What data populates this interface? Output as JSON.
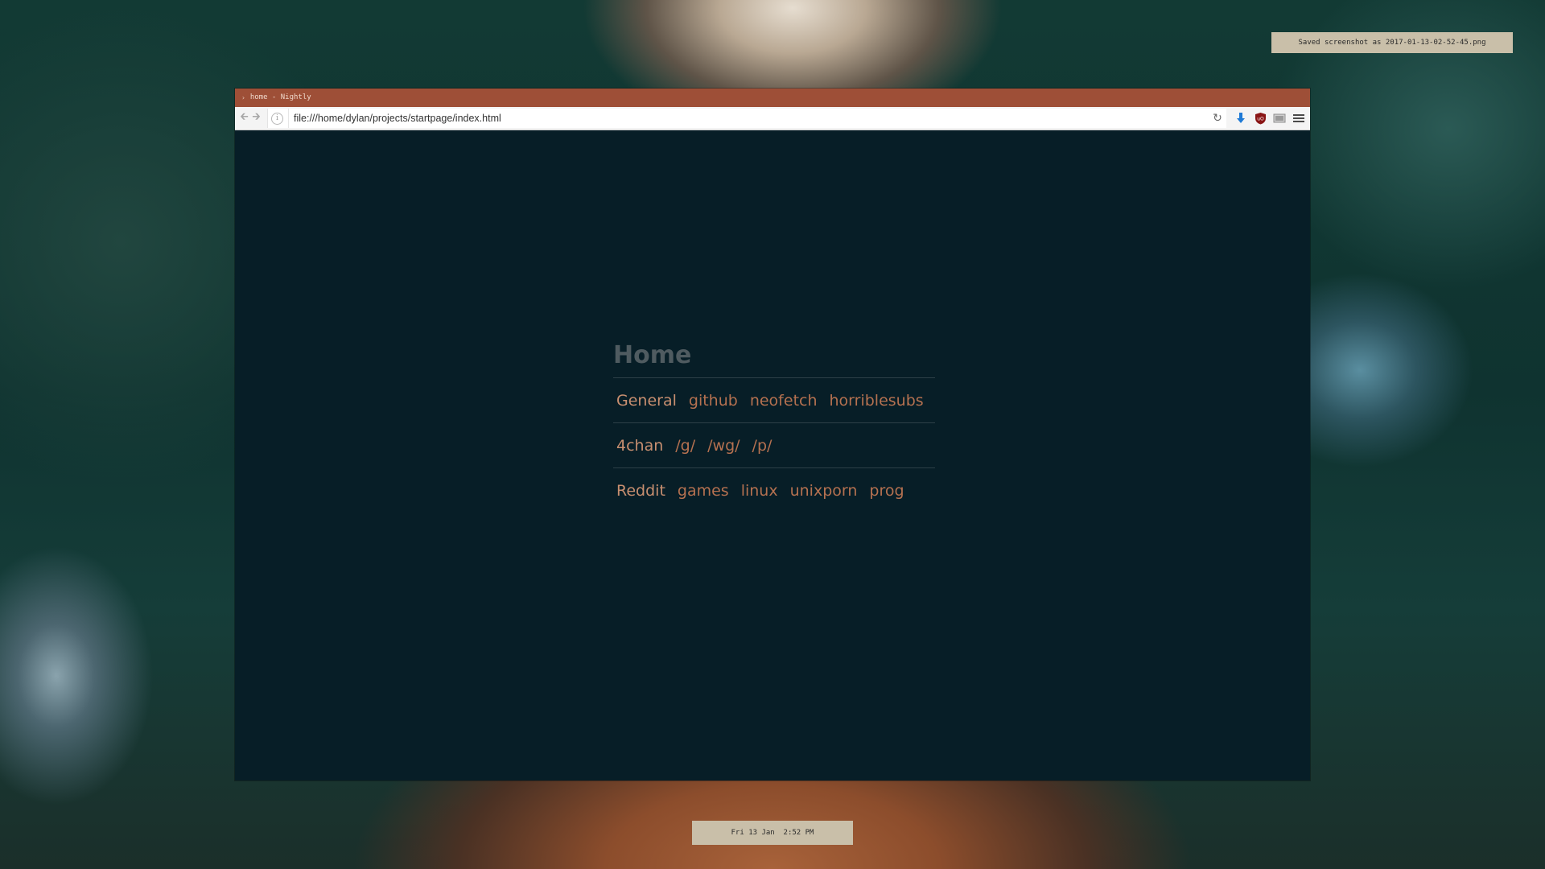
{
  "notification": {
    "text": "Saved screenshot as 2017-01-13-02-52-45.png"
  },
  "window": {
    "title": "home - Nightly"
  },
  "navbar": {
    "url": "file:///home/dylan/projects/startpage/index.html",
    "icons": [
      "back-arrow-icon",
      "forward-arrow-icon",
      "info-icon",
      "reload-icon",
      "download-icon",
      "ublock-icon",
      "extension-icon",
      "menu-icon"
    ]
  },
  "startpage": {
    "title": "Home",
    "rows": [
      {
        "heading": "General",
        "links": [
          "github",
          "neofetch",
          "horriblesubs"
        ]
      },
      {
        "heading": "4chan",
        "links": [
          "/g/",
          "/wg/",
          "/p/"
        ]
      },
      {
        "heading": "Reddit",
        "links": [
          "games",
          "linux",
          "unixporn",
          "prog"
        ]
      }
    ]
  },
  "clock": {
    "text": "Fri 13 Jan  2:52 PM"
  },
  "colors": {
    "titlebar": "#9e4f37",
    "page_bg": "#071e27",
    "link": "#b57150",
    "heading": "#c88f70",
    "bar_bg": "#c9bfa9"
  }
}
